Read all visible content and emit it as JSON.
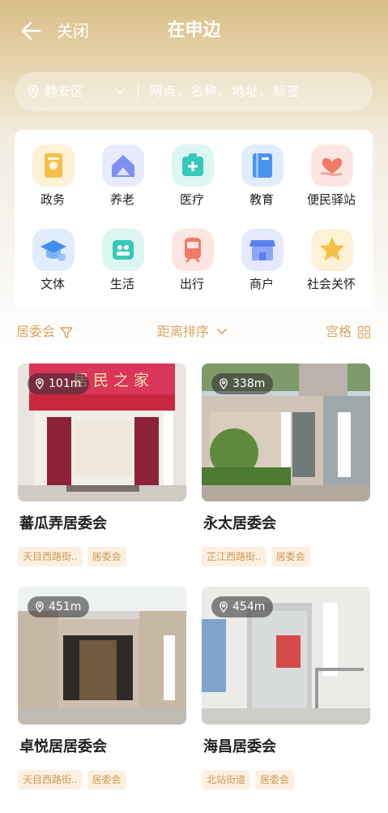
{
  "header": {
    "back_icon": "back-arrow-icon",
    "close_label": "关闭",
    "title": "在申边"
  },
  "search": {
    "district": "静安区",
    "placeholder": "网点、名称、地址、标签"
  },
  "categories": [
    {
      "label": "政务",
      "icon": "government-icon",
      "color": "#f5c046"
    },
    {
      "label": "养老",
      "icon": "elderly-care-icon",
      "color": "#7f8ff0"
    },
    {
      "label": "医疗",
      "icon": "medical-icon",
      "color": "#35c9b8"
    },
    {
      "label": "教育",
      "icon": "education-icon",
      "color": "#4a92f0"
    },
    {
      "label": "便民驿站",
      "icon": "service-station-icon",
      "color": "#f27a66"
    },
    {
      "label": "文体",
      "icon": "culture-sports-icon",
      "color": "#3f8ef0"
    },
    {
      "label": "生活",
      "icon": "life-icon",
      "color": "#35c9b8"
    },
    {
      "label": "出行",
      "icon": "transit-icon",
      "color": "#f27a66"
    },
    {
      "label": "商户",
      "icon": "merchant-icon",
      "color": "#5a7ff0"
    },
    {
      "label": "社会关怀",
      "icon": "social-care-icon",
      "color": "#f5c046"
    }
  ],
  "filters": {
    "category": "居委会",
    "sort": "距离排序",
    "view": "宫格"
  },
  "places": [
    {
      "name": "蕃瓜弄居委会",
      "distance": "101m",
      "tags": [
        "天目西路街..",
        "居委会"
      ]
    },
    {
      "name": "永太居委会",
      "distance": "338m",
      "tags": [
        "芷江西路街..",
        "居委会"
      ]
    },
    {
      "name": "卓悦居居委会",
      "distance": "451m",
      "tags": [
        "天目西路街..",
        "居委会"
      ]
    },
    {
      "name": "海昌居委会",
      "distance": "454m",
      "tags": [
        "北站街道",
        "居委会"
      ]
    }
  ],
  "photo_text": {
    "sign_1": "居民之家"
  },
  "colors": {
    "accent": "#d6a661",
    "header_gold": "#d9bf86",
    "tag_bg": "#fbf1e2",
    "tag_text": "#d0984f"
  }
}
